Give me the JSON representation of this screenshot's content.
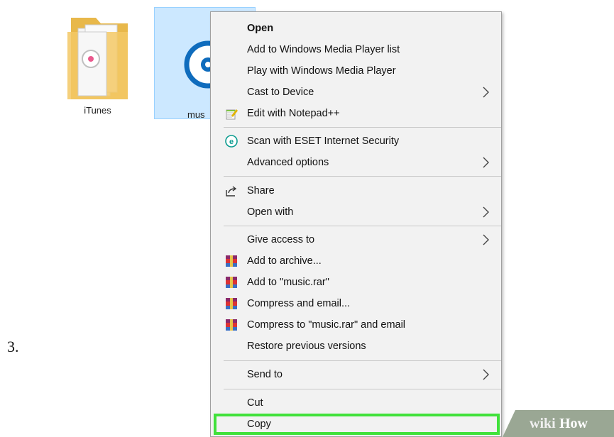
{
  "step": {
    "number": "3."
  },
  "desktop": {
    "files": [
      {
        "name": "iTunes",
        "icon": "folder-icon"
      },
      {
        "name": "mus",
        "icon": "media-file-icon",
        "selected": true
      }
    ]
  },
  "context_menu": {
    "items": [
      {
        "label": "Open",
        "bold": true
      },
      {
        "label": "Add to Windows Media Player list"
      },
      {
        "label": "Play with Windows Media Player"
      },
      {
        "label": "Cast to Device",
        "submenu": true
      },
      {
        "label": "Edit with Notepad++",
        "icon": "notepad-icon"
      },
      {
        "label": "Scan with ESET Internet Security",
        "icon": "eset-icon"
      },
      {
        "label": "Advanced options",
        "submenu": true
      },
      {
        "label": "Share",
        "icon": "share-icon"
      },
      {
        "label": "Open with",
        "submenu": true
      },
      {
        "label": "Give access to",
        "submenu": true
      },
      {
        "label": "Add to archive...",
        "icon": "winrar-icon"
      },
      {
        "label": "Add to \"music.rar\"",
        "icon": "winrar-icon"
      },
      {
        "label": "Compress and email...",
        "icon": "winrar-icon"
      },
      {
        "label": "Compress to \"music.rar\" and email",
        "icon": "winrar-icon"
      },
      {
        "label": "Restore previous versions"
      },
      {
        "label": "Send to",
        "submenu": true
      },
      {
        "label": "Cut"
      },
      {
        "label": "Copy",
        "highlighted": true
      }
    ]
  },
  "watermark": {
    "part1": "wiki",
    "part2": "How"
  },
  "colors": {
    "highlight": "#41e13b",
    "selection": "#cce8ff",
    "menu_bg": "#f2f2f2",
    "media_blue": "#0f6cbd"
  }
}
